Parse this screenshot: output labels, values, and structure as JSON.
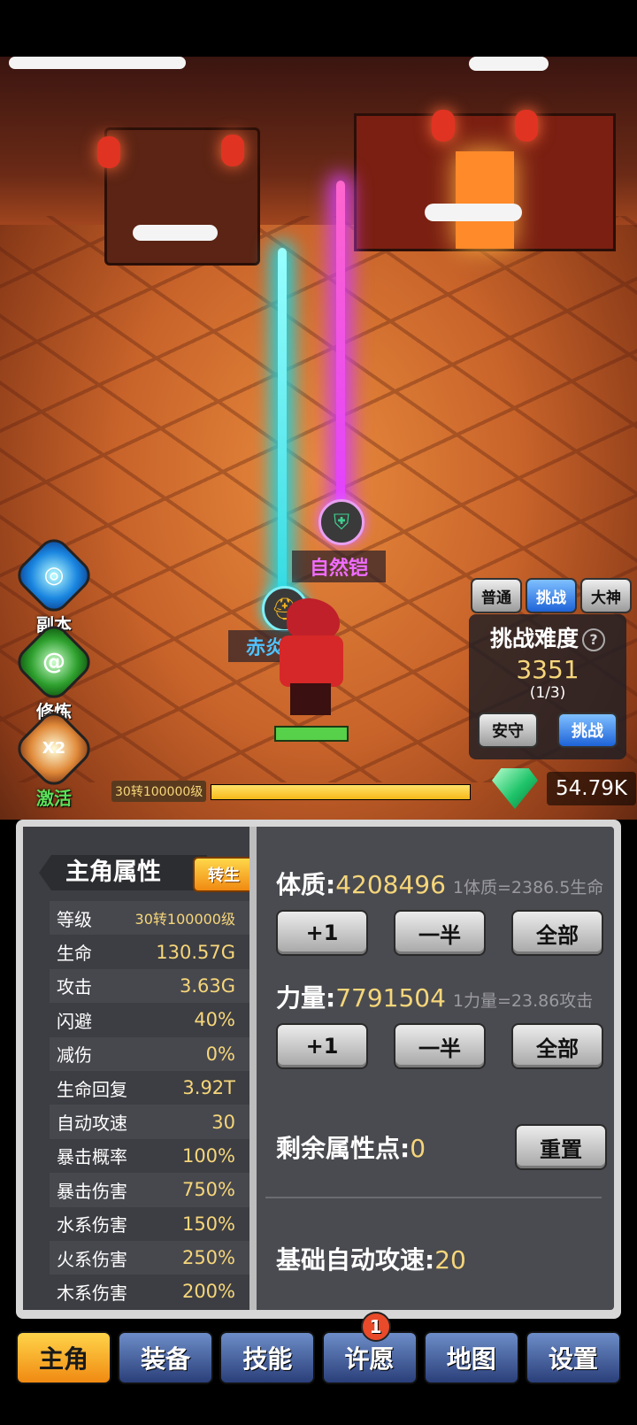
{
  "scene": {
    "drops": [
      {
        "label": "自然铠",
        "rarity_color": "#e06cff",
        "icon": "armor-icon"
      },
      {
        "label": "赤炎",
        "rarity_color": "#4fc3ff",
        "icon": "helmet-icon"
      }
    ]
  },
  "side_menu": [
    {
      "label": "副本",
      "icon": "vortex-icon"
    },
    {
      "label": "修炼",
      "icon": "green-swirl-icon"
    },
    {
      "label": "激活",
      "icon": "x2-bag-icon",
      "badge": "X2"
    }
  ],
  "mode_tabs": [
    {
      "label": "普通",
      "active": false
    },
    {
      "label": "挑战",
      "active": true
    },
    {
      "label": "大神",
      "active": false
    }
  ],
  "challenge": {
    "title": "挑战难度",
    "help_icon": "?",
    "difficulty": "3351",
    "progress": "(1/3)",
    "safe_label": "安守",
    "challenge_label": "挑战"
  },
  "level_bar": {
    "label": "30转100000级",
    "progress": 1.0
  },
  "currency": {
    "icon": "diamond-icon",
    "value": "54.79K"
  },
  "attributes": {
    "title": "主角属性",
    "rebirth_label": "转生",
    "rows": [
      {
        "k": "等级",
        "v": "30转100000级"
      },
      {
        "k": "生命",
        "v": "130.57G"
      },
      {
        "k": "攻击",
        "v": "3.63G"
      },
      {
        "k": "闪避",
        "v": "40%"
      },
      {
        "k": "减伤",
        "v": "0%"
      },
      {
        "k": "生命回复",
        "v": "3.92T"
      },
      {
        "k": "自动攻速",
        "v": "30"
      },
      {
        "k": "暴击概率",
        "v": "100%"
      },
      {
        "k": "暴击伤害",
        "v": "750%"
      },
      {
        "k": "水系伤害",
        "v": "150%"
      },
      {
        "k": "火系伤害",
        "v": "250%"
      },
      {
        "k": "木系伤害",
        "v": "200%"
      }
    ]
  },
  "allocation": {
    "constitution": {
      "label": "体质:",
      "value": "4208496",
      "hint": "1体质=2386.5生命"
    },
    "strength": {
      "label": "力量:",
      "value": "7791504",
      "hint": "1力量=23.86攻击"
    },
    "buttons": {
      "plus_one": "+1",
      "half": "一半",
      "all": "全部"
    },
    "remaining": {
      "label": "剩余属性点:",
      "value": "0",
      "reset_label": "重置"
    },
    "base_speed": {
      "label": "基础自动攻速:",
      "value": "20"
    }
  },
  "bottom_nav": [
    {
      "label": "主角",
      "active": true
    },
    {
      "label": "装备",
      "active": false
    },
    {
      "label": "技能",
      "active": false
    },
    {
      "label": "许愿",
      "active": false,
      "badge": "1"
    },
    {
      "label": "地图",
      "active": false
    },
    {
      "label": "设置",
      "active": false
    }
  ]
}
